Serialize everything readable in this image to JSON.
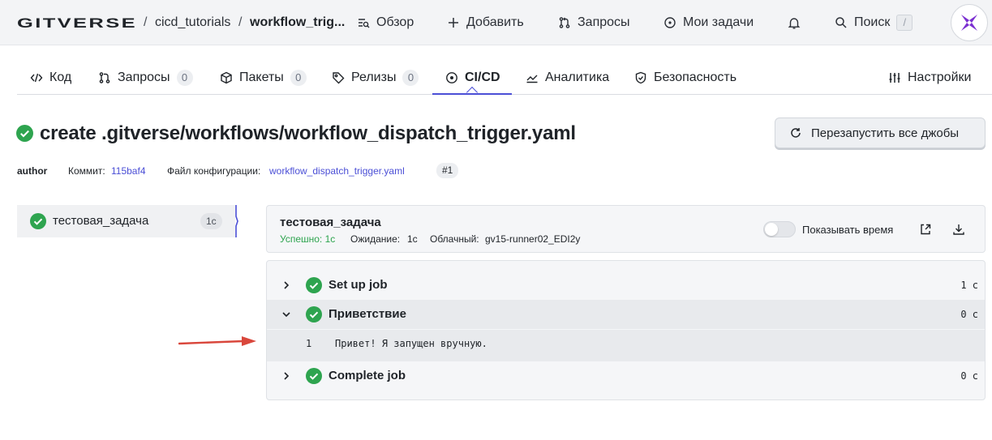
{
  "topbar": {
    "logo_text": "GITVERSE",
    "repo_owner": "cicd_tutorials",
    "separator": "/",
    "repo_name": "workflow_trig...",
    "nav": [
      {
        "label": "Обзор",
        "icon": "overview-icon"
      },
      {
        "label": "Добавить",
        "icon": "plus-icon"
      },
      {
        "label": "Запросы",
        "icon": "pull-request-icon"
      },
      {
        "label": "Мои задачи",
        "icon": "circle-dot-icon"
      }
    ],
    "search_label": "Поиск",
    "search_shortcut": "/",
    "bell_icon": "bell-icon"
  },
  "tabs": [
    {
      "label": "Код",
      "icon": "code-icon"
    },
    {
      "label": "Запросы",
      "icon": "pull-request-icon",
      "count": "0"
    },
    {
      "label": "Пакеты",
      "icon": "package-icon",
      "count": "0"
    },
    {
      "label": "Релизы",
      "icon": "tag-icon",
      "count": "0"
    },
    {
      "label": "CI/CD",
      "icon": "ci-icon",
      "active": true
    },
    {
      "label": "Аналитика",
      "icon": "chart-icon"
    },
    {
      "label": "Безопасность",
      "icon": "shield-icon"
    },
    {
      "label": "Настройки",
      "icon": "settings-sliders-icon"
    }
  ],
  "run": {
    "title": "create .gitverse/workflows/workflow_dispatch_trigger.yaml",
    "rerun_label": "Перезапустить все джобы",
    "author": "author",
    "commit_label": "Коммит:",
    "commit_hash": "115baf4",
    "config_label": "Файл конфигурации:",
    "config_file": "workflow_dispatch_trigger.yaml",
    "run_number": "#1"
  },
  "jobs": [
    {
      "name": "тестовая_задача",
      "duration": "1с",
      "status": "success"
    }
  ],
  "job_detail": {
    "name": "тестовая_задача",
    "success_label": "Успешно: 1с",
    "wait_label": "Ожидание:",
    "wait_value": "1с",
    "runner_label": "Облачный:",
    "runner_value": "gv15-runner02_EDI2y",
    "show_time_label": "Показывать время",
    "show_time_enabled": false
  },
  "steps": [
    {
      "name": "Set up job",
      "duration": "1 с",
      "expanded": false
    },
    {
      "name": "Приветствие",
      "duration": "0 с",
      "expanded": true
    },
    {
      "name": "Complete job",
      "duration": "0 с",
      "expanded": false
    }
  ],
  "log": {
    "line_number": "1",
    "line_text": "Привет! Я запущен вручную."
  },
  "colors": {
    "accent": "#4b4fd6",
    "success": "#2ea44f",
    "annotation_arrow": "#d9473c"
  }
}
